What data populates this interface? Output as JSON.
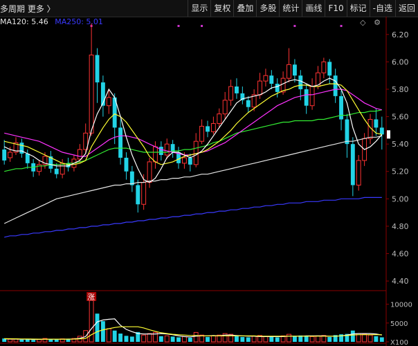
{
  "top_bar": {
    "period_label": "多周期  更多 〉",
    "buttons": [
      "显示",
      "复权",
      "叠加",
      "多股",
      "统计",
      "画线",
      "F10",
      "标记",
      "-自选",
      "返回"
    ]
  },
  "ma_legend": [
    {
      "label": "MA120: 5.46",
      "color": "#e6e6e6"
    },
    {
      "label": "MA250: 5.01",
      "color": "#3a3aff"
    }
  ],
  "icons": {
    "diamond": "diamond-icon",
    "settings": "settings-icon"
  },
  "colors": {
    "up": "#ff3333",
    "down": "#22d3e6",
    "ma5": "#ffffff",
    "ma10": "#ffff33",
    "ma20": "#ff33ff",
    "ma60": "#33ee33",
    "ma120": "#e6e6e6",
    "ma250": "#3a3aff",
    "axis": "#8b0000",
    "grid": "#5a0000"
  },
  "chart_data": [
    {
      "type": "candlestick",
      "ylim": [
        4.35,
        6.3
      ],
      "yticks": [
        "6.20",
        "6.00",
        "5.80",
        "5.60",
        "5.40",
        "5.20",
        "5.00",
        "4.80",
        "4.60",
        "4.40"
      ],
      "ytick_values": [
        6.2,
        6.0,
        5.8,
        5.6,
        5.4,
        5.2,
        5.0,
        4.8,
        4.6,
        4.4
      ],
      "annotation": "涨",
      "last_price_marker": "5.47",
      "candles": [
        [
          5.36,
          5.28,
          5.43,
          5.25
        ],
        [
          5.3,
          5.34,
          5.38,
          5.27
        ],
        [
          5.34,
          5.41,
          5.45,
          5.32
        ],
        [
          5.41,
          5.33,
          5.44,
          5.3
        ],
        [
          5.33,
          5.26,
          5.36,
          5.22
        ],
        [
          5.26,
          5.2,
          5.29,
          5.16
        ],
        [
          5.2,
          5.25,
          5.28,
          5.17
        ],
        [
          5.25,
          5.31,
          5.34,
          5.22
        ],
        [
          5.31,
          5.22,
          5.35,
          5.19
        ],
        [
          5.22,
          5.18,
          5.26,
          5.15
        ],
        [
          5.18,
          5.26,
          5.29,
          5.15
        ],
        [
          5.26,
          5.23,
          5.3,
          5.2
        ],
        [
          5.23,
          5.29,
          5.32,
          5.2
        ],
        [
          5.29,
          5.36,
          5.4,
          5.26
        ],
        [
          5.36,
          5.48,
          5.55,
          5.33
        ],
        [
          5.48,
          6.05,
          6.28,
          5.46
        ],
        [
          6.05,
          5.85,
          6.1,
          5.7
        ],
        [
          5.85,
          5.68,
          5.9,
          5.6
        ],
        [
          5.68,
          5.74,
          5.8,
          5.62
        ],
        [
          5.74,
          5.52,
          5.77,
          5.4
        ],
        [
          5.52,
          5.3,
          5.58,
          5.25
        ],
        [
          5.3,
          5.2,
          5.34,
          5.14
        ],
        [
          5.2,
          5.1,
          5.24,
          5.05
        ],
        [
          5.1,
          4.96,
          5.14,
          4.9
        ],
        [
          4.96,
          5.12,
          5.18,
          4.92
        ],
        [
          5.12,
          5.27,
          5.3,
          5.08
        ],
        [
          5.27,
          5.38,
          5.42,
          5.22
        ],
        [
          5.38,
          5.32,
          5.42,
          5.28
        ],
        [
          5.32,
          5.4,
          5.44,
          5.29
        ],
        [
          5.4,
          5.34,
          5.43,
          5.3
        ],
        [
          5.34,
          5.26,
          5.38,
          5.22
        ],
        [
          5.26,
          5.3,
          5.34,
          5.22
        ],
        [
          5.3,
          5.25,
          5.33,
          5.2
        ],
        [
          5.25,
          5.42,
          5.48,
          5.23
        ],
        [
          5.42,
          5.53,
          5.58,
          5.4
        ],
        [
          5.53,
          5.49,
          5.57,
          5.45
        ],
        [
          5.49,
          5.55,
          5.6,
          5.47
        ],
        [
          5.55,
          5.62,
          5.66,
          5.52
        ],
        [
          5.62,
          5.72,
          5.78,
          5.58
        ],
        [
          5.72,
          5.82,
          5.87,
          5.68
        ],
        [
          5.82,
          5.77,
          5.88,
          5.73
        ],
        [
          5.77,
          5.72,
          5.82,
          5.69
        ],
        [
          5.72,
          5.67,
          5.75,
          5.63
        ],
        [
          5.67,
          5.76,
          5.8,
          5.64
        ],
        [
          5.76,
          5.86,
          5.92,
          5.73
        ],
        [
          5.86,
          5.9,
          5.95,
          5.82
        ],
        [
          5.9,
          5.84,
          5.94,
          5.8
        ],
        [
          5.84,
          5.78,
          5.88,
          5.74
        ],
        [
          5.78,
          5.88,
          5.93,
          5.76
        ],
        [
          5.88,
          5.98,
          6.1,
          5.85
        ],
        [
          5.98,
          5.9,
          6.02,
          5.85
        ],
        [
          5.9,
          5.8,
          5.94,
          5.72
        ],
        [
          5.8,
          5.68,
          5.84,
          5.62
        ],
        [
          5.68,
          5.82,
          5.88,
          5.65
        ],
        [
          5.82,
          5.92,
          5.97,
          5.8
        ],
        [
          5.92,
          6.0,
          6.03,
          5.88
        ],
        [
          6.0,
          5.9,
          6.02,
          5.84
        ],
        [
          5.9,
          5.75,
          5.95,
          5.7
        ],
        [
          5.75,
          5.58,
          5.79,
          5.5
        ],
        [
          5.58,
          5.4,
          5.62,
          5.3
        ],
        [
          5.4,
          5.1,
          5.45,
          5.02
        ],
        [
          5.1,
          5.28,
          5.32,
          5.06
        ],
        [
          5.28,
          5.44,
          5.48,
          5.24
        ],
        [
          5.44,
          5.58,
          5.62,
          5.4
        ],
        [
          5.58,
          5.52,
          5.66,
          5.46
        ],
        [
          5.52,
          5.47,
          5.6,
          5.36
        ]
      ],
      "ma5": [
        5.38,
        5.36,
        5.35,
        5.35,
        5.33,
        5.31,
        5.28,
        5.26,
        5.25,
        5.24,
        5.24,
        5.24,
        5.26,
        5.28,
        5.33,
        5.5,
        5.62,
        5.7,
        5.8,
        5.74,
        5.6,
        5.45,
        5.32,
        5.22,
        5.14,
        5.12,
        5.15,
        5.22,
        5.3,
        5.34,
        5.34,
        5.32,
        5.3,
        5.32,
        5.35,
        5.4,
        5.46,
        5.52,
        5.58,
        5.64,
        5.7,
        5.73,
        5.74,
        5.75,
        5.76,
        5.78,
        5.81,
        5.82,
        5.84,
        5.86,
        5.87,
        5.86,
        5.84,
        5.82,
        5.83,
        5.86,
        5.88,
        5.86,
        5.8,
        5.7,
        5.52,
        5.4,
        5.36,
        5.38,
        5.42,
        5.47
      ],
      "ma10": [
        5.42,
        5.41,
        5.4,
        5.39,
        5.38,
        5.36,
        5.34,
        5.32,
        5.3,
        5.28,
        5.26,
        5.25,
        5.25,
        5.26,
        5.28,
        5.38,
        5.45,
        5.52,
        5.58,
        5.62,
        5.6,
        5.56,
        5.5,
        5.44,
        5.38,
        5.31,
        5.27,
        5.25,
        5.26,
        5.27,
        5.29,
        5.31,
        5.32,
        5.33,
        5.34,
        5.36,
        5.39,
        5.42,
        5.46,
        5.5,
        5.55,
        5.59,
        5.63,
        5.66,
        5.69,
        5.72,
        5.75,
        5.77,
        5.79,
        5.8,
        5.82,
        5.83,
        5.83,
        5.82,
        5.82,
        5.83,
        5.84,
        5.84,
        5.83,
        5.79,
        5.72,
        5.65,
        5.58,
        5.52,
        5.48,
        5.47
      ],
      "ma20": [
        5.48,
        5.47,
        5.46,
        5.45,
        5.44,
        5.43,
        5.42,
        5.4,
        5.38,
        5.36,
        5.34,
        5.33,
        5.32,
        5.31,
        5.31,
        5.34,
        5.37,
        5.4,
        5.43,
        5.45,
        5.46,
        5.46,
        5.45,
        5.44,
        5.42,
        5.4,
        5.38,
        5.36,
        5.35,
        5.34,
        5.33,
        5.32,
        5.32,
        5.33,
        5.34,
        5.35,
        5.37,
        5.39,
        5.41,
        5.44,
        5.47,
        5.5,
        5.53,
        5.56,
        5.59,
        5.62,
        5.65,
        5.68,
        5.7,
        5.72,
        5.74,
        5.75,
        5.76,
        5.76,
        5.77,
        5.78,
        5.79,
        5.8,
        5.8,
        5.79,
        5.76,
        5.73,
        5.7,
        5.68,
        5.66,
        5.65
      ],
      "ma60": [
        5.2,
        5.21,
        5.22,
        5.22,
        5.23,
        5.23,
        5.24,
        5.24,
        5.25,
        5.25,
        5.25,
        5.26,
        5.26,
        5.27,
        5.28,
        5.3,
        5.32,
        5.34,
        5.36,
        5.37,
        5.37,
        5.37,
        5.36,
        5.35,
        5.34,
        5.34,
        5.34,
        5.34,
        5.34,
        5.35,
        5.35,
        5.36,
        5.36,
        5.37,
        5.38,
        5.39,
        5.41,
        5.42,
        5.44,
        5.46,
        5.48,
        5.49,
        5.5,
        5.51,
        5.52,
        5.53,
        5.54,
        5.55,
        5.56,
        5.56,
        5.57,
        5.57,
        5.57,
        5.57,
        5.58,
        5.58,
        5.59,
        5.6,
        5.61,
        5.61,
        5.62,
        5.63,
        5.63,
        5.64,
        5.64,
        5.65
      ],
      "ma120": [
        4.82,
        4.84,
        4.86,
        4.88,
        4.9,
        4.92,
        4.94,
        4.96,
        4.98,
        5.0,
        5.01,
        5.02,
        5.03,
        5.04,
        5.05,
        5.06,
        5.07,
        5.08,
        5.09,
        5.1,
        5.1,
        5.11,
        5.11,
        5.12,
        5.12,
        5.13,
        5.13,
        5.14,
        5.14,
        5.15,
        5.15,
        5.16,
        5.16,
        5.17,
        5.18,
        5.18,
        5.19,
        5.2,
        5.21,
        5.22,
        5.23,
        5.24,
        5.25,
        5.26,
        5.27,
        5.28,
        5.29,
        5.3,
        5.31,
        5.32,
        5.33,
        5.34,
        5.35,
        5.36,
        5.37,
        5.38,
        5.39,
        5.4,
        5.41,
        5.42,
        5.42,
        5.43,
        5.44,
        5.45,
        5.45,
        5.46
      ],
      "ma250": [
        4.72,
        4.73,
        4.73,
        4.74,
        4.74,
        4.75,
        4.75,
        4.76,
        4.76,
        4.77,
        4.77,
        4.78,
        4.78,
        4.79,
        4.79,
        4.8,
        4.8,
        4.81,
        4.81,
        4.82,
        4.82,
        4.83,
        4.83,
        4.84,
        4.84,
        4.85,
        4.85,
        4.86,
        4.86,
        4.87,
        4.87,
        4.88,
        4.88,
        4.89,
        4.89,
        4.9,
        4.9,
        4.91,
        4.91,
        4.92,
        4.92,
        4.93,
        4.93,
        4.94,
        4.94,
        4.95,
        4.95,
        4.96,
        4.96,
        4.97,
        4.97,
        4.97,
        4.98,
        4.98,
        4.98,
        4.99,
        4.99,
        4.99,
        5.0,
        5.0,
        5.0,
        5.0,
        5.01,
        5.01,
        5.01,
        5.01
      ]
    },
    {
      "type": "bar",
      "ylim": [
        0,
        12500
      ],
      "yticks": [
        "10000",
        "5000",
        "X100"
      ],
      "ytick_values": [
        10000,
        5000,
        0
      ],
      "volumes": [
        900,
        700,
        800,
        600,
        700,
        500,
        600,
        900,
        700,
        600,
        800,
        700,
        900,
        1500,
        3000,
        11000,
        7500,
        5500,
        3500,
        3000,
        2200,
        1600,
        1400,
        2600,
        1800,
        2200,
        2500,
        1500,
        1600,
        1400,
        1200,
        1400,
        1100,
        2500,
        1800,
        1300,
        1600,
        1800,
        2200,
        2000,
        1500,
        1300,
        1200,
        1500,
        1700,
        1400,
        1300,
        1200,
        1600,
        2000,
        1500,
        1700,
        1500,
        1400,
        1600,
        1700,
        1300,
        1800,
        2000,
        2100,
        3000,
        2200,
        2000,
        1800,
        1500,
        1200
      ],
      "ma5": [
        800,
        750,
        740,
        700,
        700,
        650,
        660,
        700,
        720,
        700,
        720,
        740,
        760,
        950,
        1400,
        3500,
        5300,
        5800,
        6000,
        6100,
        4400,
        3300,
        2700,
        2200,
        2100,
        2100,
        2100,
        2200,
        2100,
        1900,
        1600,
        1400,
        1300,
        1500,
        1600,
        1600,
        1700,
        1600,
        1800,
        1800,
        1700,
        1600,
        1500,
        1500,
        1400,
        1400,
        1400,
        1400,
        1400,
        1500,
        1500,
        1500,
        1600,
        1600,
        1600,
        1600,
        1500,
        1500,
        1600,
        1800,
        2100,
        2200,
        2200,
        2200,
        2100,
        1800
      ],
      "ma10": [
        850,
        820,
        800,
        780,
        760,
        740,
        720,
        720,
        720,
        710,
        710,
        720,
        740,
        800,
        900,
        1900,
        2700,
        3200,
        3500,
        3800,
        4000,
        4000,
        4000,
        4000,
        3700,
        3200,
        2800,
        2400,
        2200,
        2000,
        1900,
        1800,
        1700,
        1700,
        1600,
        1600,
        1600,
        1600,
        1600,
        1600,
        1600,
        1600,
        1600,
        1600,
        1500,
        1500,
        1500,
        1500,
        1500,
        1500,
        1500,
        1500,
        1500,
        1500,
        1500,
        1500,
        1500,
        1500,
        1600,
        1700,
        1800,
        1900,
        1900,
        1900,
        1900,
        1900
      ]
    }
  ]
}
